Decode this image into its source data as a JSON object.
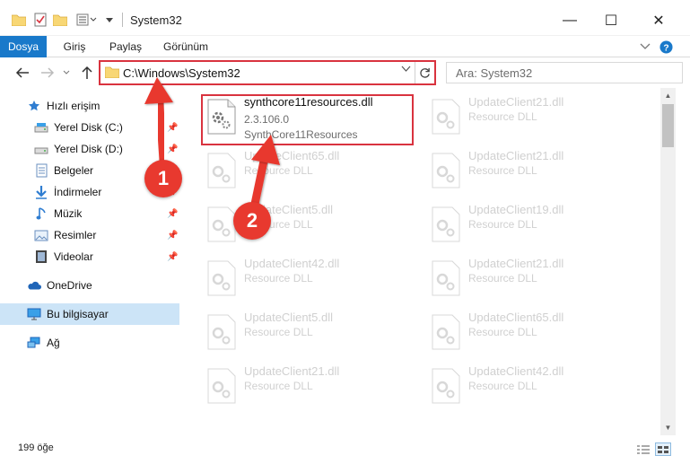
{
  "window": {
    "title": "System32",
    "minimize": "—",
    "maximize": "☐",
    "close": "✕"
  },
  "ribbon": {
    "tabs": [
      {
        "label": "Dosya",
        "active": true
      },
      {
        "label": "Giriş",
        "active": false
      },
      {
        "label": "Paylaş",
        "active": false
      },
      {
        "label": "Görünüm",
        "active": false
      }
    ]
  },
  "address": {
    "path": "C:\\Windows\\System32",
    "search_placeholder": "Ara: System32"
  },
  "sidebar": {
    "quick_access": "Hızlı erişim",
    "items": [
      {
        "label": "Yerel Disk (C:)",
        "icon": "drive-icon",
        "pinned": true
      },
      {
        "label": "Yerel Disk (D:)",
        "icon": "drive-icon",
        "pinned": true
      },
      {
        "label": "Belgeler",
        "icon": "documents-icon",
        "pinned": true
      },
      {
        "label": "İndirmeler",
        "icon": "download-icon",
        "pinned": true
      },
      {
        "label": "Müzik",
        "icon": "music-icon",
        "pinned": true
      },
      {
        "label": "Resimler",
        "icon": "pictures-icon",
        "pinned": true
      },
      {
        "label": "Videolar",
        "icon": "videos-icon",
        "pinned": true
      }
    ],
    "onedrive": "OneDrive",
    "this_pc": "Bu bilgisayar",
    "network": "Ağ"
  },
  "files": {
    "highlighted": {
      "name": "synthcore11resources.dll",
      "version": "2.3.106.0",
      "description": "SynthCore11Resources"
    },
    "background": [
      {
        "name": "UpdateClient65.dll",
        "type": "Resource DLL"
      },
      {
        "name": "UpdateClient5.dll",
        "type": "Resource DLL"
      },
      {
        "name": "UpdateClient42.dll",
        "type": "Resource DLL"
      },
      {
        "name": "UpdateClient5.dll",
        "type": "Resource DLL"
      },
      {
        "name": "UpdateClient21.dll",
        "type": "Resource DLL"
      },
      {
        "name": "UpdateClient21.dll",
        "type": "Resource DLL"
      },
      {
        "name": "UpdateClient21.dll",
        "type": "Resource DLL"
      },
      {
        "name": "UpdateClient19.dll",
        "type": "Resource DLL"
      },
      {
        "name": "UpdateClient21.dll",
        "type": "Resource DLL"
      },
      {
        "name": "UpdateClient65.dll",
        "type": "Resource DLL"
      },
      {
        "name": "UpdateClient42.dll",
        "type": "Resource DLL"
      }
    ]
  },
  "status": {
    "item_count": "199 öğe"
  },
  "annotations": {
    "step1": "1",
    "step2": "2",
    "highlight_color": "#d9333f",
    "callout_color": "#e8392f"
  },
  "colors": {
    "accent": "#1979ca",
    "selected_nav": "#cce4f7"
  }
}
